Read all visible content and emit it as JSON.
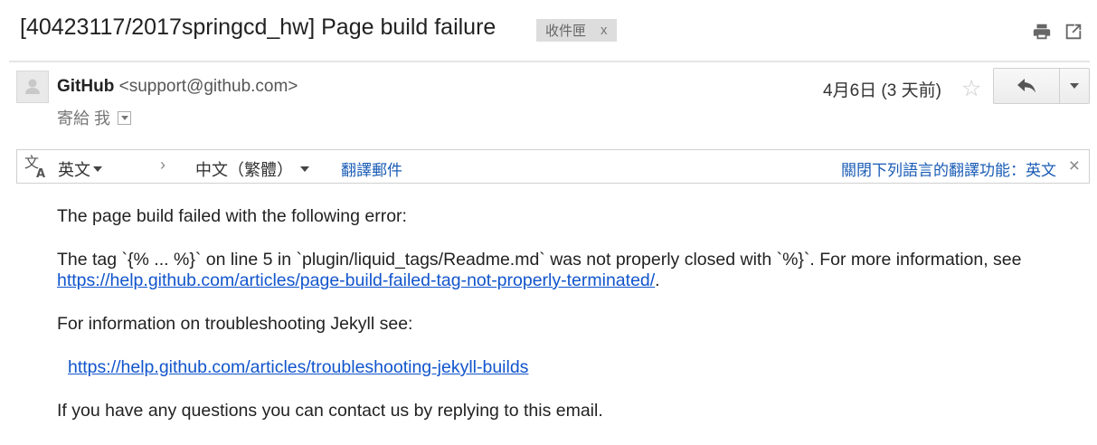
{
  "header": {
    "subject": "[40423117/2017springcd_hw] Page build failure",
    "label": "收件匣",
    "label_remove": "x",
    "print_icon": "printer-icon",
    "popout_icon": "new-window-icon"
  },
  "message": {
    "sender_name": "GitHub",
    "sender_email": "<support@github.com>",
    "to_text": "寄給 我",
    "date": "4月6日 (3 天前)",
    "star_glyph": "☆"
  },
  "translate": {
    "source_lang": "英文",
    "arrow": "›",
    "target_lang": "中文（繁體）",
    "action": "翻譯郵件",
    "turn_off": "關閉下列語言的翻譯功能：英文",
    "close": "×"
  },
  "body": {
    "line1": "The page build failed with the following error:",
    "line2_pre": "The tag `{% ... %}` on line 5 in `plugin/liquid_tags/Readme.md` was not properly closed with `%}`. For more information, see ",
    "link1": "https://help.github.com/articles/page-build-failed-tag-not-properly-terminated/",
    "line2_post": ".",
    "line3": "For information on troubleshooting Jekyll see:",
    "link2": "https://help.github.com/articles/troubleshooting-jekyll-builds",
    "line4": "If you have any questions you can contact us by replying to this email."
  },
  "colors": {
    "link": "#1155cc",
    "translate_link": "#1a5cb6",
    "label_bg": "#dddddd"
  }
}
